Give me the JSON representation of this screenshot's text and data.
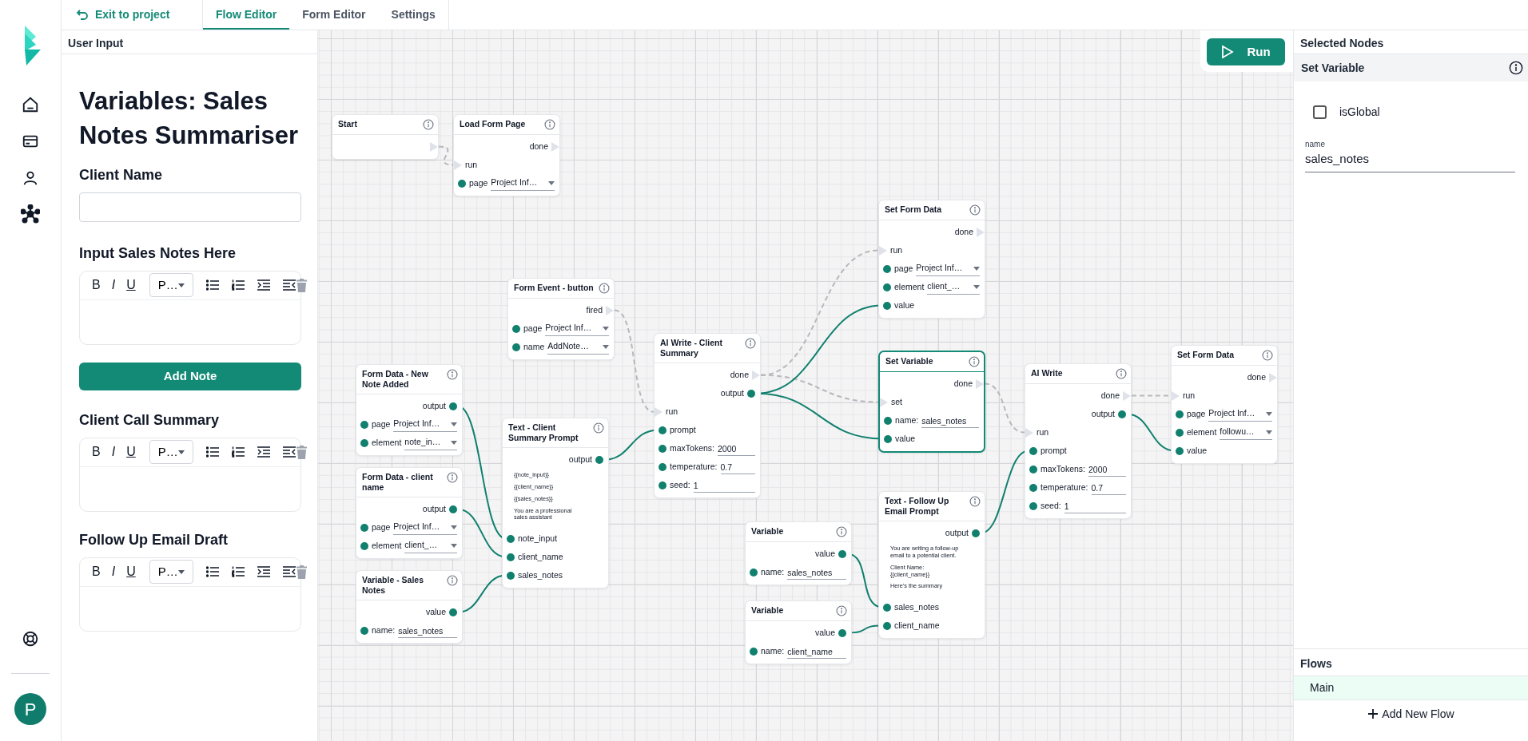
{
  "topbar": {
    "exit_link": "Exit to project",
    "tabs": [
      {
        "label": "Flow Editor",
        "selected": true
      },
      {
        "label": "Form Editor",
        "selected": false
      },
      {
        "label": "Settings",
        "selected": false
      }
    ]
  },
  "user": {
    "avatar_initial": "P"
  },
  "user_input": {
    "header": "User Input",
    "title": "Variables: Sales Notes Summariser",
    "items": [
      {
        "kind": "text_input",
        "label": "Client Name"
      },
      {
        "kind": "rich_text",
        "label": "Input Sales Notes Here",
        "format_buttons": [
          "B",
          "I",
          "U"
        ],
        "block_format": "P…"
      },
      {
        "kind": "button",
        "label": "Add Note"
      },
      {
        "kind": "rich_text",
        "label": "Client Call Summary",
        "format_buttons": [
          "B",
          "I",
          "U"
        ],
        "block_format": "P…"
      },
      {
        "kind": "rich_text",
        "label": "Follow Up Email Draft",
        "format_buttons": [
          "B",
          "I",
          "U"
        ],
        "block_format": "P…"
      }
    ]
  },
  "canvas": {
    "run_button": "Run",
    "nodes": [
      {
        "title": "Start",
        "selected": false,
        "rows": [
          {
            "kind": "exec_out"
          }
        ]
      },
      {
        "title": "Load Form Page",
        "selected": false,
        "rows": [
          {
            "kind": "exec_out",
            "label": "done"
          },
          {
            "kind": "exec_in",
            "label": "run"
          },
          {
            "kind": "select",
            "label": "page",
            "value": "Project Inf…"
          }
        ]
      },
      {
        "title": "Form Event - button",
        "selected": false,
        "rows": [
          {
            "kind": "exec_out",
            "label": "fired"
          },
          {
            "kind": "select",
            "label": "page",
            "value": "Project Inf…"
          },
          {
            "kind": "select",
            "label": "name",
            "value": "AddNote…"
          }
        ]
      },
      {
        "title": "Form Data - New Note Added",
        "selected": false,
        "rows": [
          {
            "kind": "data_out",
            "label": "output"
          },
          {
            "kind": "select",
            "label": "page",
            "value": "Project Inf…"
          },
          {
            "kind": "select",
            "label": "element",
            "value": "note_in…"
          }
        ]
      },
      {
        "title": "Form Data - client name",
        "selected": false,
        "rows": [
          {
            "kind": "data_out",
            "label": "output"
          },
          {
            "kind": "select",
            "label": "page",
            "value": "Project Inf…"
          },
          {
            "kind": "select",
            "label": "element",
            "value": "client_…"
          }
        ]
      },
      {
        "title": "Variable - Sales Notes",
        "selected": false,
        "rows": [
          {
            "kind": "data_out",
            "label": "value"
          },
          {
            "kind": "field",
            "label": "name:",
            "value": "sales_notes"
          }
        ]
      },
      {
        "title": "Text - Client Summary Prompt",
        "selected": false,
        "rows": [
          {
            "kind": "data_out",
            "label": "output"
          },
          {
            "kind": "text",
            "lines": [
              "{{note_input}}",
              "{{client_name}}",
              "{{sales_notes}}",
              "You are a professional sales assistant"
            ]
          },
          {
            "kind": "data_in",
            "label": "note_input"
          },
          {
            "kind": "data_in",
            "label": "client_name"
          },
          {
            "kind": "data_in",
            "label": "sales_notes"
          }
        ]
      },
      {
        "title": "AI Write - Client Summary",
        "selected": false,
        "rows": [
          {
            "kind": "exec_out",
            "label": "done"
          },
          {
            "kind": "data_out",
            "label": "output"
          },
          {
            "kind": "exec_in",
            "label": "run"
          },
          {
            "kind": "data_in",
            "label": "prompt"
          },
          {
            "kind": "field",
            "label": "maxTokens:",
            "value": "2000"
          },
          {
            "kind": "field",
            "label": "temperature:",
            "value": "0.7"
          },
          {
            "kind": "field",
            "label": "seed:",
            "value": "1"
          }
        ]
      },
      {
        "title": "Set Form Data",
        "selected": false,
        "rows": [
          {
            "kind": "exec_out",
            "label": "done"
          },
          {
            "kind": "exec_in",
            "label": "run"
          },
          {
            "kind": "select",
            "label": "page",
            "value": "Project Inf…"
          },
          {
            "kind": "select",
            "label": "element",
            "value": "client_…"
          },
          {
            "kind": "data_in",
            "label": "value"
          }
        ]
      },
      {
        "title": "Set Variable",
        "selected": true,
        "rows": [
          {
            "kind": "exec_out",
            "label": "done"
          },
          {
            "kind": "exec_in",
            "label": "set"
          },
          {
            "kind": "field",
            "label": "name:",
            "value": "sales_notes"
          },
          {
            "kind": "data_in",
            "label": "value"
          }
        ]
      },
      {
        "title": "Text - Follow Up Email Prompt",
        "selected": false,
        "rows": [
          {
            "kind": "data_out",
            "label": "output"
          },
          {
            "kind": "text",
            "lines": [
              "You are writing a follow-up email to a potential client.",
              "Client Name: {{client_name}}",
              "Here's the summary"
            ]
          },
          {
            "kind": "data_in",
            "label": "sales_notes"
          },
          {
            "kind": "data_in",
            "label": "client_name"
          }
        ]
      },
      {
        "title": "Variable",
        "selected": false,
        "rows": [
          {
            "kind": "data_out",
            "label": "value"
          },
          {
            "kind": "field",
            "label": "name:",
            "value": "sales_notes"
          }
        ]
      },
      {
        "title": "Variable",
        "selected": false,
        "rows": [
          {
            "kind": "data_out",
            "label": "value"
          },
          {
            "kind": "field",
            "label": "name:",
            "value": "client_name"
          }
        ]
      },
      {
        "title": "AI Write",
        "selected": false,
        "rows": [
          {
            "kind": "exec_out",
            "label": "done"
          },
          {
            "kind": "data_out",
            "label": "output"
          },
          {
            "kind": "exec_in",
            "label": "run"
          },
          {
            "kind": "data_in",
            "label": "prompt"
          },
          {
            "kind": "field",
            "label": "maxTokens:",
            "value": "2000"
          },
          {
            "kind": "field",
            "label": "temperature:",
            "value": "0.7"
          },
          {
            "kind": "field",
            "label": "seed:",
            "value": "1"
          }
        ]
      },
      {
        "title": "Set Form Data",
        "selected": false,
        "rows": [
          {
            "kind": "exec_out",
            "label": "done"
          },
          {
            "kind": "exec_in",
            "label": "run"
          },
          {
            "kind": "select",
            "label": "page",
            "value": "Project Inf…"
          },
          {
            "kind": "select",
            "label": "element",
            "value": "followu…"
          },
          {
            "kind": "data_in",
            "label": "value"
          }
        ]
      }
    ]
  },
  "inspector": {
    "header": "Selected Nodes",
    "node_title": "Set Variable",
    "checkbox": {
      "label": "isGlobal",
      "checked": false
    },
    "field": {
      "label": "name",
      "value": "sales_notes"
    }
  },
  "flows": {
    "header": "Flows",
    "items": [
      {
        "name": "Main",
        "selected": true
      }
    ],
    "add_button": "Add New Flow"
  }
}
